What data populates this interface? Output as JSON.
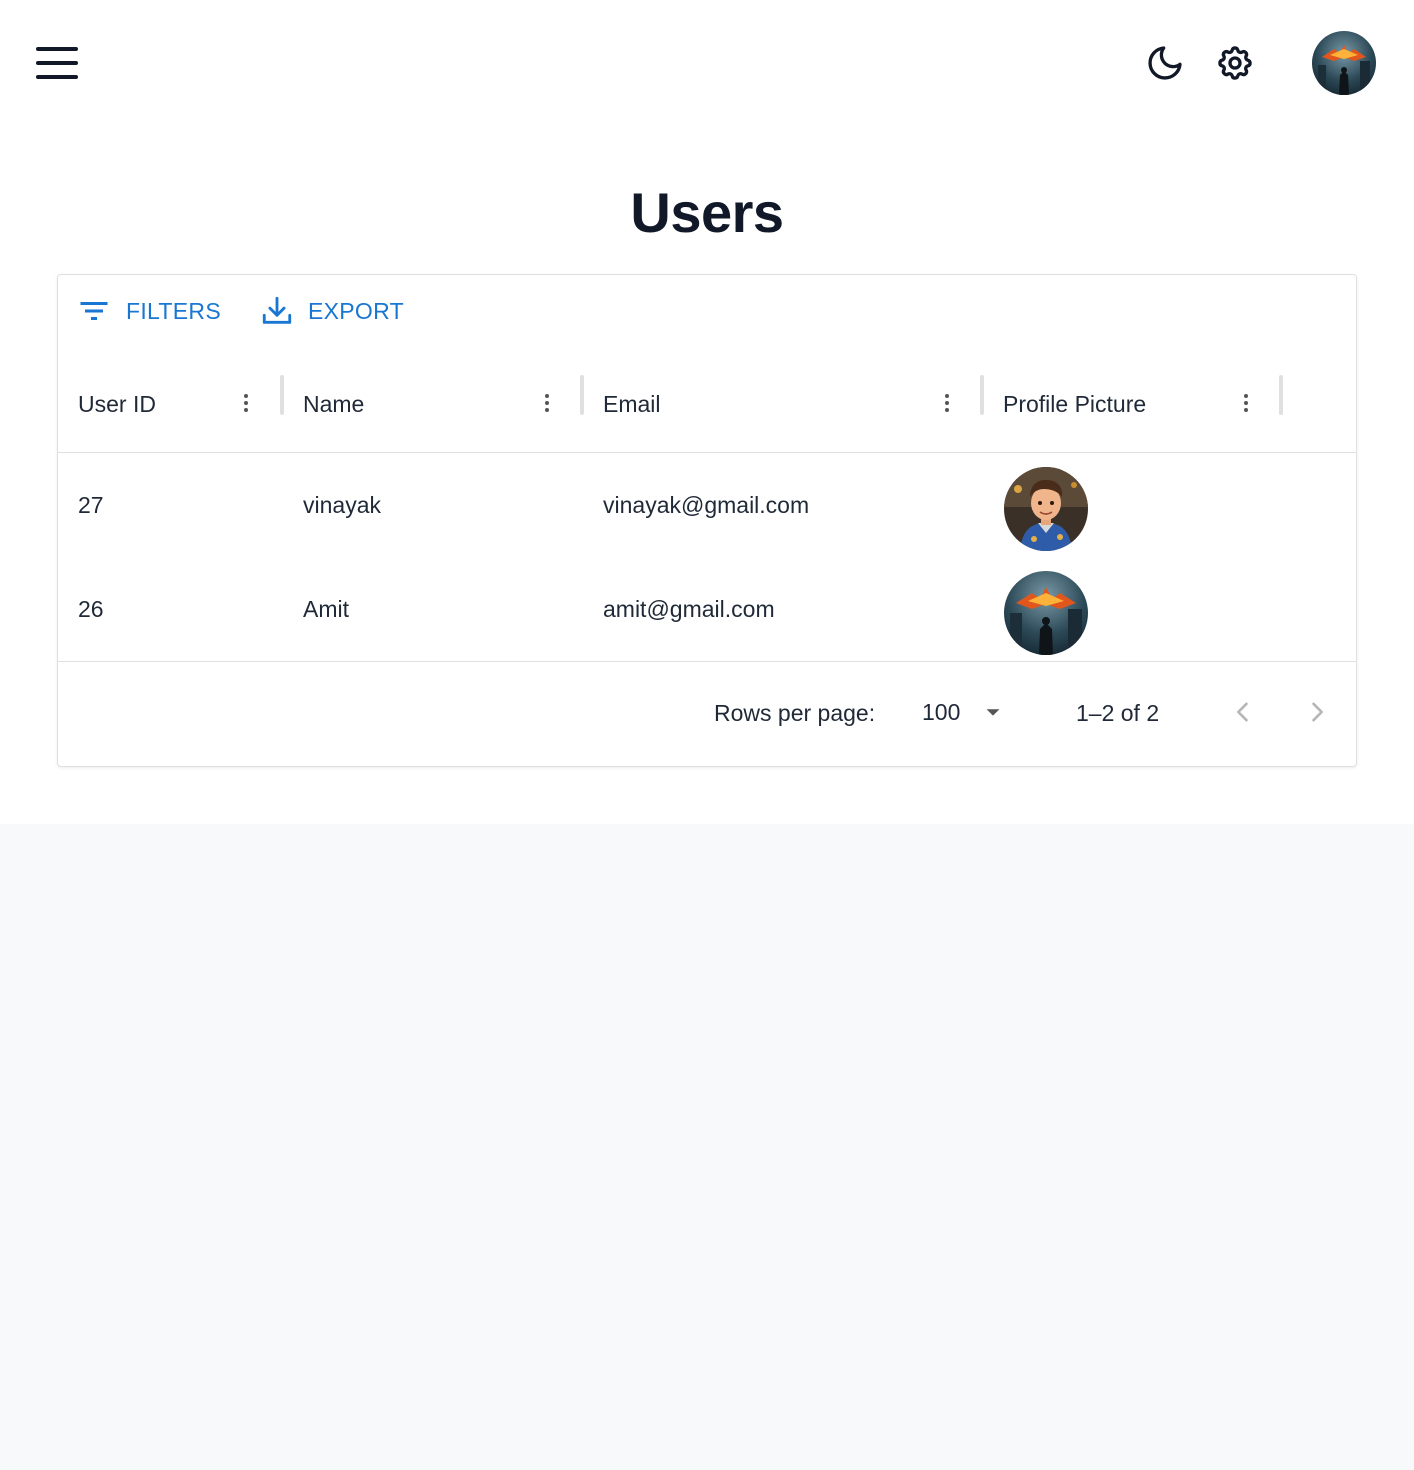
{
  "header": {
    "menu_icon": "hamburger-icon",
    "theme_icon": "moon-icon",
    "settings_icon": "gear-icon"
  },
  "page": {
    "title": "Users"
  },
  "toolbar": {
    "filters_label": "FILTERS",
    "export_label": "EXPORT",
    "accent": "#1976d2"
  },
  "table": {
    "columns": [
      "User ID",
      "Name",
      "Email",
      "Profile Picture"
    ],
    "rows": [
      {
        "id": "27",
        "name": "vinayak",
        "email": "vinayak@gmail.com"
      },
      {
        "id": "26",
        "name": "Amit",
        "email": "amit@gmail.com"
      }
    ]
  },
  "pagination": {
    "rows_per_page_label": "Rows per page:",
    "rows_per_page": "100",
    "range": "1–2 of 2"
  }
}
